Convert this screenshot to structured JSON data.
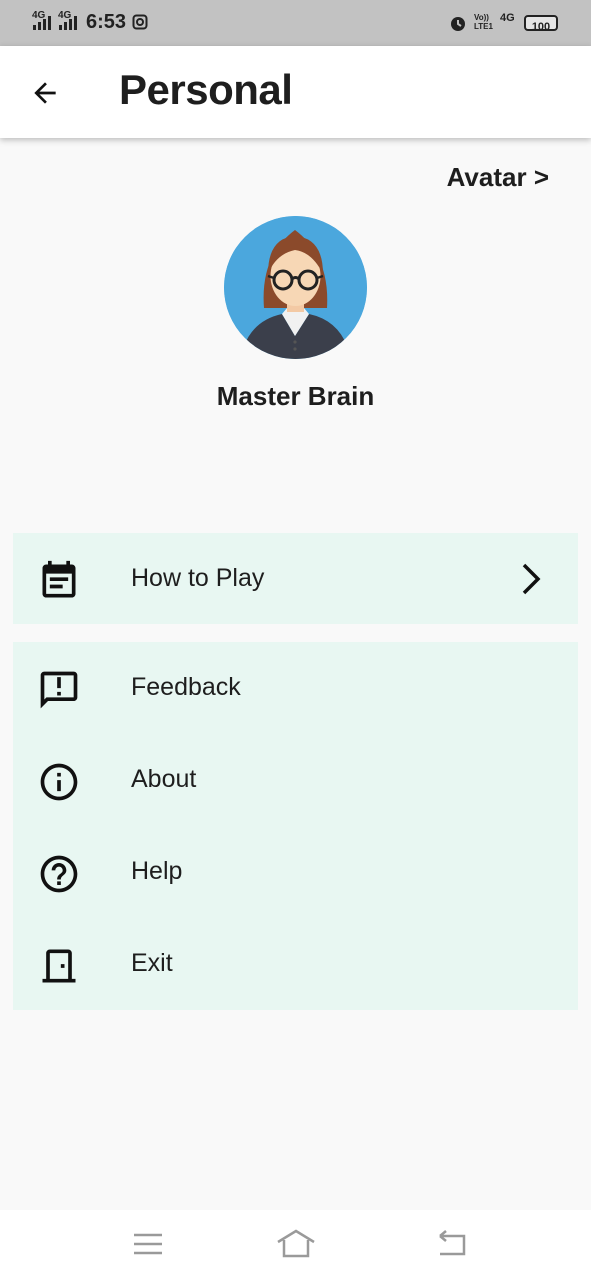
{
  "status_bar": {
    "signal_1": "4G",
    "signal_2": "4G",
    "time": "6:53",
    "volte": "Vo)) LTE1",
    "network": "4G",
    "battery": "100"
  },
  "header": {
    "title": "Personal"
  },
  "profile": {
    "avatar_link": "Avatar >",
    "name": "Master Brain"
  },
  "menu": {
    "primary": [
      {
        "label": "How to Play",
        "icon": "event-note-icon"
      }
    ],
    "secondary": [
      {
        "label": "Feedback",
        "icon": "feedback-icon"
      },
      {
        "label": "About",
        "icon": "info-icon"
      },
      {
        "label": "Help",
        "icon": "help-icon"
      },
      {
        "label": "Exit",
        "icon": "door-icon"
      }
    ]
  },
  "colors": {
    "status_bar": "#c2c2c2",
    "background": "#f9f9f9",
    "card": "#e8f7f2",
    "avatar_bg": "#4ba7dd"
  }
}
